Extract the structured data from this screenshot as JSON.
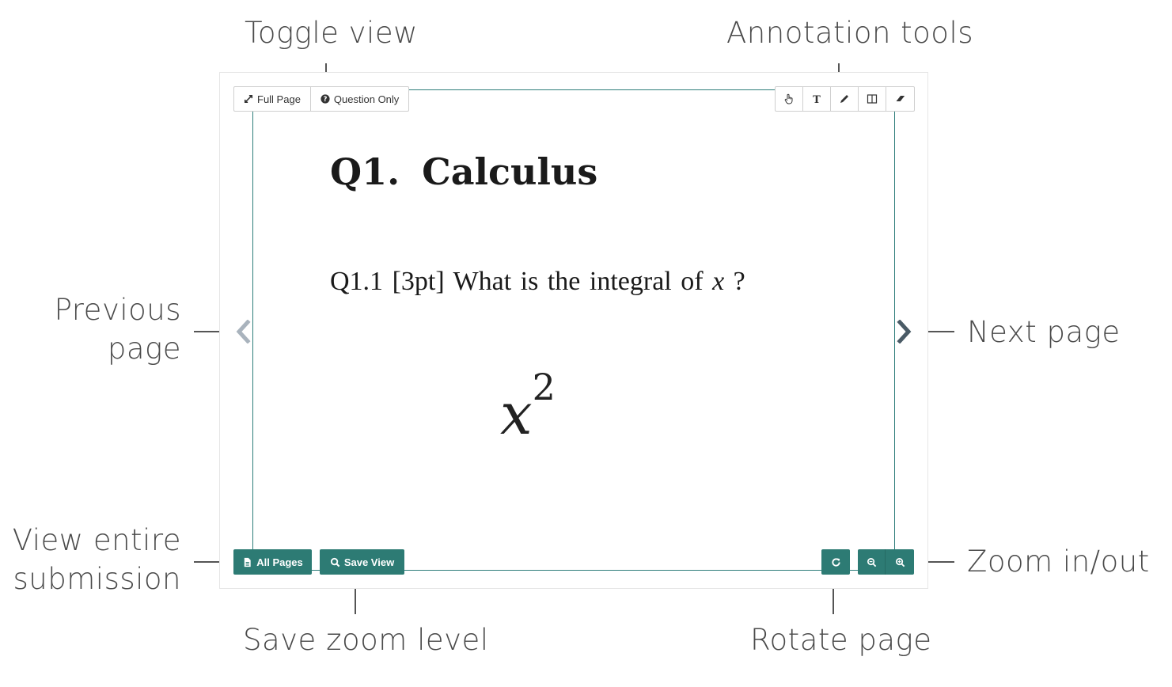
{
  "annotations": {
    "toggle_view": "Toggle view",
    "annotation_tools": "Annotation tools",
    "previous_page_line1": "Previous",
    "previous_page_line2": "page",
    "next_page": "Next page",
    "view_entire_line1": "View entire",
    "view_entire_line2": "submission",
    "zoom_in_out": "Zoom in/out",
    "save_zoom_level": "Save zoom level",
    "rotate_page": "Rotate page"
  },
  "toolbar": {
    "full_page": "Full Page",
    "question_only": "Question Only",
    "tools": [
      "hand-pointer-icon",
      "text-tool-icon",
      "pencil-icon",
      "split-view-icon",
      "eraser-icon"
    ]
  },
  "bottom_bar": {
    "all_pages": "All Pages",
    "save_view": "Save View"
  },
  "document": {
    "title_q": "Q1.",
    "title_subject": "Calculus",
    "question_number": "Q1.1",
    "points": "[3pt]",
    "question_text": "What is the integral of",
    "variable": "x",
    "question_mark": "?",
    "answer_base": "x",
    "answer_exponent": "2"
  },
  "colors": {
    "accent_green": "#2d7b74",
    "page_border": "#2e7d7a",
    "chevron_disabled": "#a9b3bd",
    "chevron_active": "#4a5b66"
  }
}
